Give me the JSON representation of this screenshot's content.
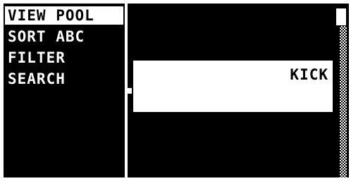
{
  "menu": {
    "items": [
      {
        "label": "VIEW POOL",
        "selected": true
      },
      {
        "label": "SORT ABC",
        "selected": false
      },
      {
        "label": "FILTER",
        "selected": false
      },
      {
        "label": "SEARCH",
        "selected": false
      }
    ]
  },
  "list": {
    "items": [
      "KICK"
    ]
  },
  "colors": {
    "background": "#000000",
    "foreground": "#ffffff"
  }
}
